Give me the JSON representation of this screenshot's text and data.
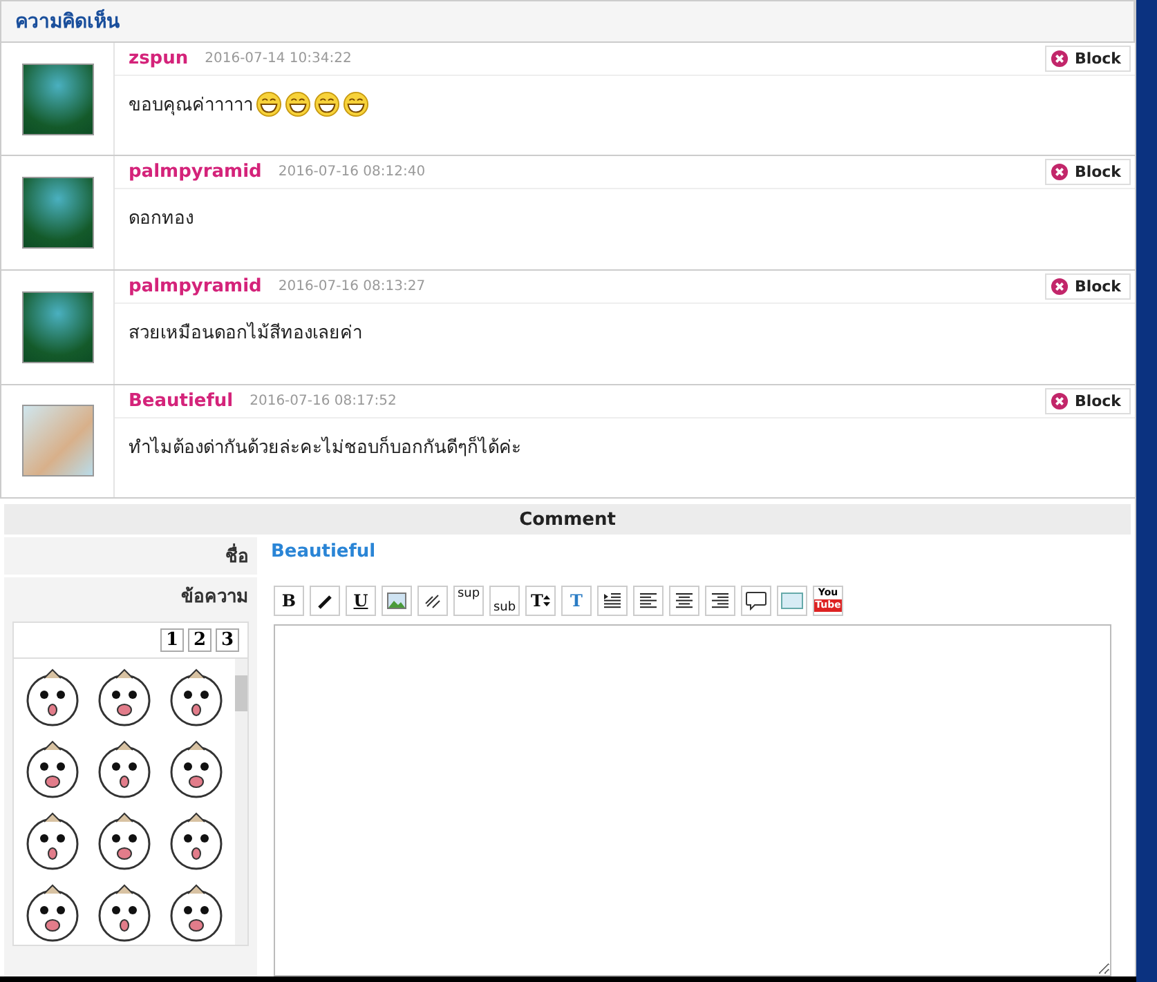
{
  "section_title": "ความคิดเห็น",
  "comments": [
    {
      "name": "zspun",
      "time": "2016-07-14 10:34:22",
      "message": "ขอบคุณค่าาาาา",
      "emojis": [
        {
          "kind": "grin"
        },
        {
          "kind": "grin"
        },
        {
          "kind": "grin"
        },
        {
          "kind": "grin"
        }
      ],
      "kind": "logo",
      "block": "Block"
    },
    {
      "name": "palmpyramid",
      "time": "2016-07-16 08:12:40",
      "message": "ดอกทอง",
      "kind": "logo",
      "block": "Block"
    },
    {
      "name": "palmpyramid",
      "time": "2016-07-16 08:13:27",
      "message": "สวยเหมือนดอกไม้สีทองเลยค่า",
      "kind": "logo",
      "block": "Block"
    },
    {
      "name": "Beautieful",
      "time": "2016-07-16 08:17:52",
      "message": "ทำไมต้องด่ากันด้วยล่ะคะไม่ชอบก็บอกกันดีๆก็ได้ค่ะ",
      "kind": "photo",
      "block": "Block"
    }
  ],
  "form": {
    "title": "Comment",
    "name_label": "ชื่อ",
    "name_value": "Beautieful",
    "message_label": "ข้อความ",
    "sticker_pages": [
      {
        "label": "1",
        "selected": false
      },
      {
        "label": "2",
        "selected": false
      },
      {
        "label": "3",
        "selected": false
      }
    ],
    "toolbar": [
      {
        "kind": "bold",
        "label": "B"
      },
      {
        "kind": "italic"
      },
      {
        "kind": "underline",
        "label": "U"
      },
      {
        "kind": "image"
      },
      {
        "kind": "link"
      },
      {
        "kind": "sup",
        "label": "sup"
      },
      {
        "kind": "sub",
        "label": "sub"
      },
      {
        "kind": "size",
        "label": "T"
      },
      {
        "kind": "color",
        "label": "T"
      },
      {
        "kind": "indent"
      },
      {
        "kind": "left"
      },
      {
        "kind": "center"
      },
      {
        "kind": "right"
      },
      {
        "kind": "quote"
      },
      {
        "kind": "box"
      },
      {
        "kind": "video",
        "label": "You",
        "label2": "Tube"
      }
    ]
  }
}
